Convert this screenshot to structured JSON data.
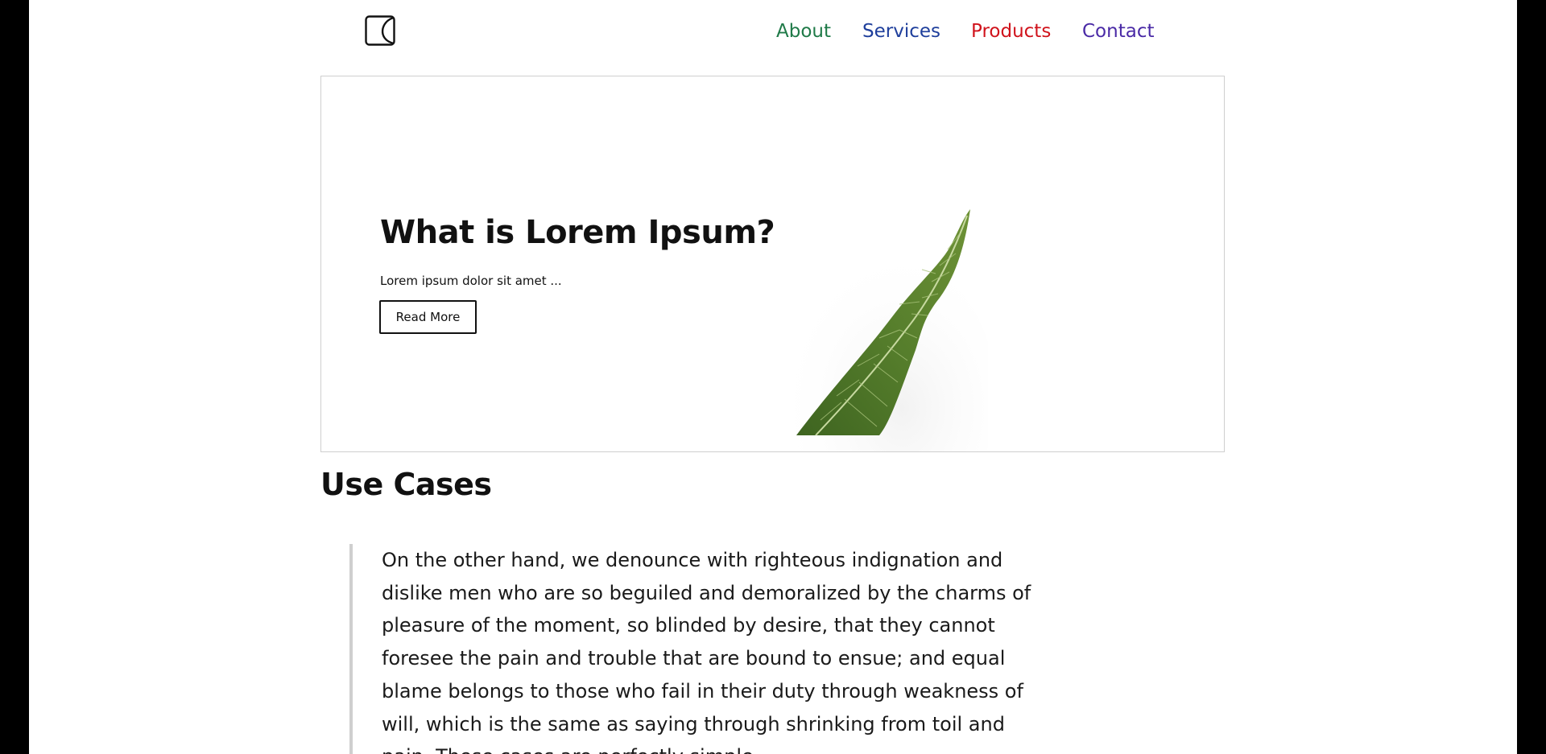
{
  "header": {
    "logo_icon": "logo-icon",
    "nav": [
      {
        "label": "About",
        "color": "#1f7a48"
      },
      {
        "label": "Services",
        "color": "#1f3f9c"
      },
      {
        "label": "Products",
        "color": "#d0131c"
      },
      {
        "label": "Contact",
        "color": "#4a2aa6"
      }
    ]
  },
  "hero": {
    "title": "What is Lorem Ipsum?",
    "text": "Lorem ipsum dolor sit amet ...",
    "button_label": "Read More",
    "image_icon": "leaf-image"
  },
  "use_cases": {
    "title": "Use Cases",
    "quote": "On the other hand, we denounce with righteous indignation and dislike men who are so beguiled and demoralized by the charms of pleasure of the moment, so blinded by desire, that they cannot foresee the pain and trouble that are bound to ensue; and equal blame belongs to those who fail in their duty through weakness of will, which is the same as saying through shrinking from toil and pain. These cases are perfectly simple"
  }
}
